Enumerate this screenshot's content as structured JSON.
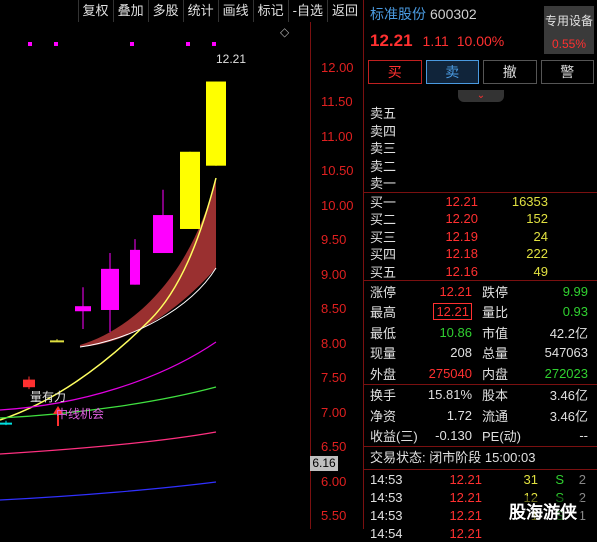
{
  "toolbar": {
    "buttons": [
      "复权",
      "叠加",
      "多股",
      "统计",
      "画线",
      "标记",
      "-自选",
      "返回"
    ]
  },
  "chart": {
    "diamond": "◇",
    "high_label": "12.21",
    "price_tag": "6.16",
    "annotation_volume": "量有力",
    "annotation_trend": "中线机会",
    "axis_ticks": [
      "12.00",
      "11.50",
      "11.00",
      "10.50",
      "10.00",
      "9.50",
      "9.00",
      "8.50",
      "8.00",
      "7.50",
      "7.00",
      "6.50",
      "6.00",
      "5.50"
    ]
  },
  "chart_data": {
    "type": "candlestick",
    "ylim": [
      5.25,
      12.55
    ],
    "candles": [
      {
        "open": 6.8,
        "close": 6.82,
        "high": 6.85,
        "low": 6.78,
        "color": "#00e0e0"
      },
      {
        "open": 7.38,
        "close": 7.5,
        "high": 7.55,
        "low": 7.35,
        "color": "#ff3030"
      },
      {
        "open": 8.1,
        "close": 8.12,
        "high": 8.14,
        "low": 8.1,
        "color": "#e0e040"
      },
      {
        "open": 8.58,
        "close": 8.66,
        "high": 8.96,
        "low": 8.3,
        "color": "#ff00ff"
      },
      {
        "open": 8.6,
        "close": 9.25,
        "high": 9.5,
        "low": 8.25,
        "color": "#ff00ff"
      },
      {
        "open": 9.0,
        "close": 9.55,
        "high": 9.72,
        "low": 9.0,
        "color": "#ff00ff"
      },
      {
        "open": 9.5,
        "close": 10.1,
        "high": 10.5,
        "low": 9.5,
        "color": "#ff00ff"
      },
      {
        "open": 9.88,
        "close": 11.1,
        "high": 11.1,
        "low": 9.88,
        "color": "#ffff00"
      },
      {
        "open": 10.88,
        "close": 12.21,
        "high": 12.21,
        "low": 10.88,
        "color": "#ffff00"
      }
    ]
  },
  "stock": {
    "name": "标准股份",
    "code": "600302",
    "last": "12.21",
    "change": "1.11",
    "change_pct": "10.00%",
    "special_label": "专用设备",
    "special_value": "0.55%"
  },
  "actions": [
    "买",
    "卖",
    "撤",
    "警"
  ],
  "collapse_icon": "⌄",
  "asks": [
    {
      "label": "卖五",
      "price": "",
      "qty": ""
    },
    {
      "label": "卖四",
      "price": "",
      "qty": ""
    },
    {
      "label": "卖三",
      "price": "",
      "qty": ""
    },
    {
      "label": "卖二",
      "price": "",
      "qty": ""
    },
    {
      "label": "卖一",
      "price": "",
      "qty": ""
    }
  ],
  "bids": [
    {
      "label": "买一",
      "price": "12.21",
      "qty": "16353"
    },
    {
      "label": "买二",
      "price": "12.20",
      "qty": "152"
    },
    {
      "label": "买三",
      "price": "12.19",
      "qty": "24"
    },
    {
      "label": "买四",
      "price": "12.18",
      "qty": "222"
    },
    {
      "label": "买五",
      "price": "12.16",
      "qty": "49"
    }
  ],
  "stats": [
    {
      "k": "涨停",
      "v": "12.21",
      "vc": "red",
      "k2": "跌停",
      "v2": "9.99",
      "v2c": "green"
    },
    {
      "k": "最高",
      "v": "12.21",
      "vc": "red",
      "k2": "量比",
      "v2": "0.93",
      "v2c": "green"
    },
    {
      "k": "最低",
      "v": "10.86",
      "vc": "green",
      "k2": "市值",
      "v2": "42.2亿",
      "v2c": "white"
    },
    {
      "k": "现量",
      "v": "208",
      "vc": "white",
      "k2": "总量",
      "v2": "547063",
      "v2c": "white"
    },
    {
      "k": "外盘",
      "v": "275040",
      "vc": "red",
      "k2": "内盘",
      "v2": "272023",
      "v2c": "green"
    }
  ],
  "fundamentals": [
    {
      "k": "换手",
      "v": "15.81%",
      "k2": "股本",
      "v2": "3.46亿"
    },
    {
      "k": "净资",
      "v": "1.72",
      "k2": "流通",
      "v2": "3.46亿"
    },
    {
      "k": "收益(三)",
      "v": "-0.130",
      "k2": "PE(动)",
      "v2": "--"
    }
  ],
  "status_text": "交易状态: 闭市阶段 15:00:03",
  "ticks": [
    {
      "time": "14:53",
      "price": "12.21",
      "vol": "31",
      "side": "S",
      "num": "2"
    },
    {
      "time": "14:53",
      "price": "12.21",
      "vol": "12",
      "side": "S",
      "num": "2"
    },
    {
      "time": "14:53",
      "price": "12.21",
      "vol": "1",
      "side": "S",
      "num": "1"
    },
    {
      "time": "14:54",
      "price": "12.21",
      "vol": "",
      "side": "",
      "num": ""
    }
  ],
  "watermark": "股海游侠"
}
